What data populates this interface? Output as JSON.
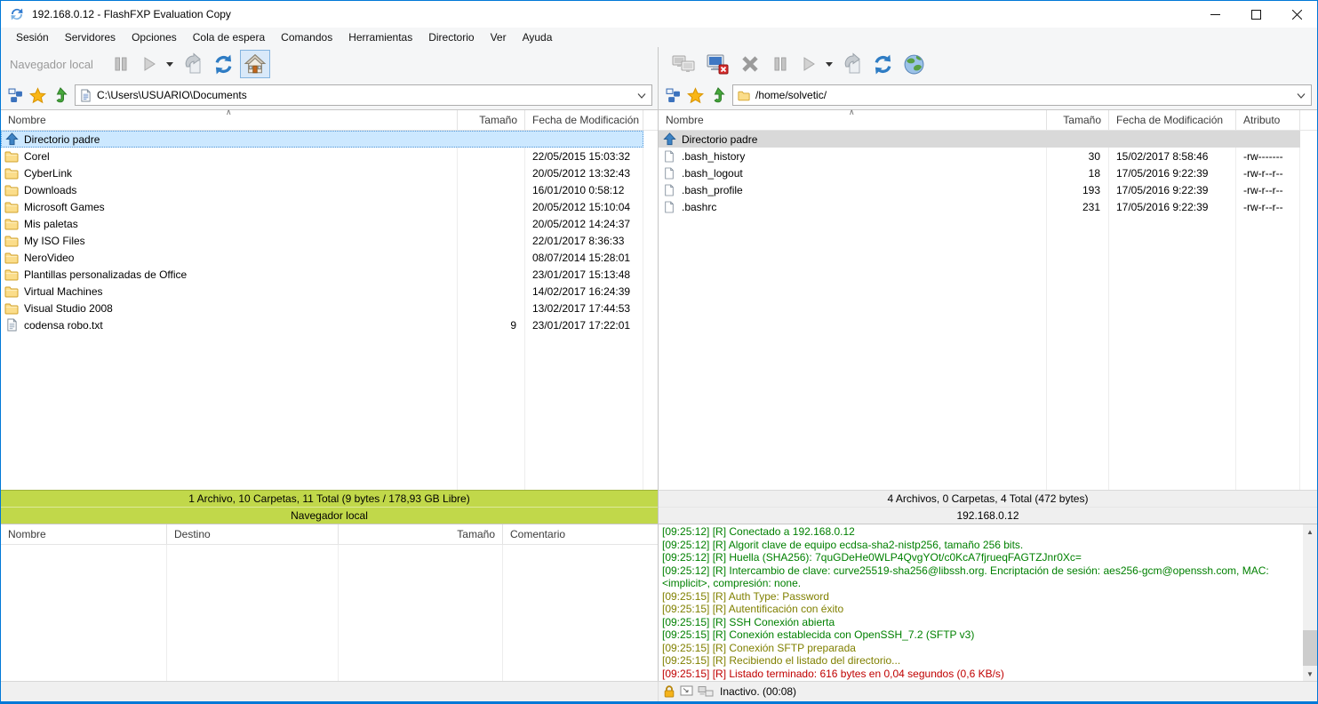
{
  "titlebar": {
    "title": "192.168.0.12 - FlashFXP Evaluation Copy"
  },
  "menubar": {
    "items": [
      "Sesión",
      "Servidores",
      "Opciones",
      "Cola de espera",
      "Comandos",
      "Herramientas",
      "Directorio",
      "Ver",
      "Ayuda"
    ]
  },
  "left": {
    "browser_label": "Navegador local",
    "path": "C:\\Users\\USUARIO\\Documents",
    "columns": [
      "Nombre",
      "Tamaño",
      "Fecha de Modificación"
    ],
    "rows": [
      {
        "icon": "up",
        "state": "sel-active",
        "name": "Directorio padre",
        "size": "",
        "date": ""
      },
      {
        "icon": "folder",
        "state": "",
        "name": "Corel",
        "size": "",
        "date": "22/05/2015 15:03:32"
      },
      {
        "icon": "folder",
        "state": "",
        "name": "CyberLink",
        "size": "",
        "date": "20/05/2012 13:32:43"
      },
      {
        "icon": "folder",
        "state": "",
        "name": "Downloads",
        "size": "",
        "date": "16/01/2010 0:58:12"
      },
      {
        "icon": "folder",
        "state": "",
        "name": "Microsoft Games",
        "size": "",
        "date": "20/05/2012 15:10:04"
      },
      {
        "icon": "folder",
        "state": "",
        "name": "Mis paletas",
        "size": "",
        "date": "20/05/2012 14:24:37"
      },
      {
        "icon": "folder",
        "state": "",
        "name": "My ISO Files",
        "size": "",
        "date": "22/01/2017 8:36:33"
      },
      {
        "icon": "folder",
        "state": "",
        "name": "NeroVideo",
        "size": "",
        "date": "08/07/2014 15:28:01"
      },
      {
        "icon": "folder",
        "state": "",
        "name": "Plantillas personalizadas de Office",
        "size": "",
        "date": "23/01/2017 15:13:48"
      },
      {
        "icon": "folder",
        "state": "",
        "name": "Virtual Machines",
        "size": "",
        "date": "14/02/2017 16:24:39"
      },
      {
        "icon": "folder",
        "state": "",
        "name": "Visual Studio 2008",
        "size": "",
        "date": "13/02/2017 17:44:53"
      },
      {
        "icon": "doc",
        "state": "",
        "name": "codensa robo.txt",
        "size": "9",
        "date": "23/01/2017 17:22:01"
      }
    ],
    "status_counts": "1 Archivo, 10 Carpetas, 11 Total (9 bytes / 178,93 GB Libre)",
    "status_label": "Navegador local"
  },
  "right": {
    "path": "/home/solvetic/",
    "columns": [
      "Nombre",
      "Tamaño",
      "Fecha de Modificación",
      "Atributo"
    ],
    "rows": [
      {
        "icon": "up",
        "state": "sel-inactive",
        "name": "Directorio padre",
        "size": "",
        "date": "",
        "attr": ""
      },
      {
        "icon": "doc",
        "state": "",
        "name": ".bash_history",
        "size": "30",
        "date": "15/02/2017 8:58:46",
        "attr": "-rw-------"
      },
      {
        "icon": "doc",
        "state": "",
        "name": ".bash_logout",
        "size": "18",
        "date": "17/05/2016 9:22:39",
        "attr": "-rw-r--r--"
      },
      {
        "icon": "doc",
        "state": "",
        "name": ".bash_profile",
        "size": "193",
        "date": "17/05/2016 9:22:39",
        "attr": "-rw-r--r--"
      },
      {
        "icon": "doc",
        "state": "",
        "name": ".bashrc",
        "size": "231",
        "date": "17/05/2016 9:22:39",
        "attr": "-rw-r--r--"
      }
    ],
    "status_counts": "4 Archivos, 0 Carpetas, 4 Total (472 bytes)",
    "status_host": "192.168.0.12"
  },
  "queue": {
    "columns": [
      "Nombre",
      "Destino",
      "Tamaño",
      "Comentario"
    ]
  },
  "log": {
    "lines": [
      {
        "color": "green",
        "text": "[09:25:12] [R] Conectado a 192.168.0.12"
      },
      {
        "color": "green",
        "text": "[09:25:12] [R] Algorit clave de equipo ecdsa-sha2-nistp256, tamaño 256 bits."
      },
      {
        "color": "green",
        "text": "[09:25:12] [R] Huella (SHA256): 7quGDeHe0WLP4QvgYOt/c0KcA7fjrueqFAGTZJnr0Xc="
      },
      {
        "color": "green",
        "text": "[09:25:12] [R] Intercambio de clave: curve25519-sha256@libssh.org. Encriptación de sesión: aes256-gcm@openssh.com, MAC: <implicit>, compresión: none."
      },
      {
        "color": "olive",
        "text": "[09:25:15] [R] Auth Type: Password"
      },
      {
        "color": "olive",
        "text": "[09:25:15] [R] Autentificación con éxito"
      },
      {
        "color": "green",
        "text": "[09:25:15] [R] SSH Conexión abierta"
      },
      {
        "color": "green",
        "text": "[09:25:15] [R] Conexión establecida con OpenSSH_7.2 (SFTP v3)"
      },
      {
        "color": "olive",
        "text": "[09:25:15] [R] Conexión SFTP preparada"
      },
      {
        "color": "olive",
        "text": "[09:25:15] [R] Recibiendo el listado del directorio..."
      },
      {
        "color": "red",
        "text": "[09:25:15] [R] Listado terminado: 616 bytes en 0,04 segundos (0,6 KB/s)"
      }
    ]
  },
  "statusbar": {
    "text": "Inactivo. (00:08)"
  },
  "colors": {
    "accent": "#0078d7",
    "band_green": "#c1d84a",
    "selection_active": "#cce8ff",
    "selection_inactive": "#d9d9d9",
    "log_green": "#008000",
    "log_olive": "#808000",
    "log_red": "#c00000"
  }
}
